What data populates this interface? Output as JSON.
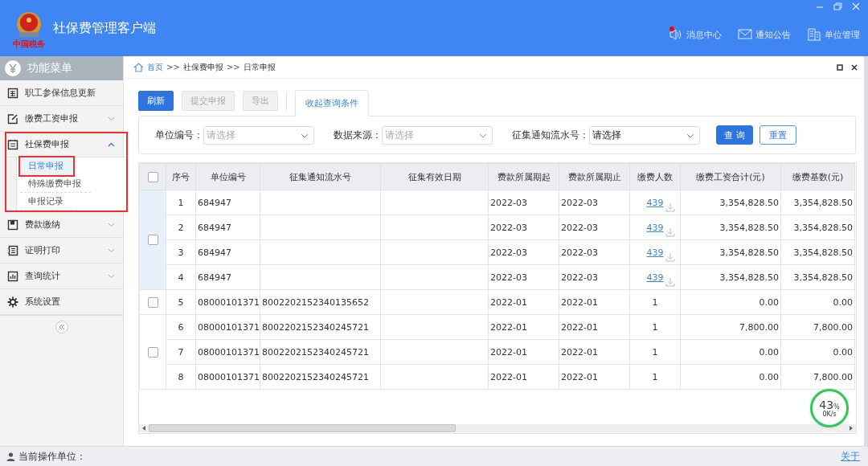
{
  "window": {
    "title": "社保费管理客户端",
    "logo_caption": "中国税务"
  },
  "header_nav": [
    {
      "label": "消息中心",
      "kind": "message",
      "unread": true
    },
    {
      "label": "通知公告",
      "kind": "notice",
      "unread": false
    },
    {
      "label": "单位管理",
      "kind": "unit",
      "unread": false
    }
  ],
  "sidebar": {
    "title": "功能菜单",
    "items": [
      {
        "label": "职工参保信息更新"
      },
      {
        "label": "缴费工资申报",
        "expanded": false
      },
      {
        "label": "社保费申报",
        "expanded": true,
        "annotated": true,
        "children": [
          {
            "label": "日常申报",
            "selected": true,
            "annotated": true
          },
          {
            "label": "特殊缴费申报",
            "selected": false
          },
          {
            "label": "申报记录",
            "selected": false
          }
        ]
      },
      {
        "label": "费款缴纳",
        "expanded": false
      },
      {
        "label": "证明打印",
        "expanded": false
      },
      {
        "label": "查询统计",
        "expanded": false
      },
      {
        "label": "系统设置"
      }
    ]
  },
  "breadcrumb": [
    {
      "text": "首页",
      "kind": "link"
    },
    {
      "text": ">>",
      "kind": "sep"
    },
    {
      "text": "社保费申报",
      "kind": "text"
    },
    {
      "text": ">>",
      "kind": "sep"
    },
    {
      "text": "日常申报",
      "kind": "text"
    }
  ],
  "toolbar": [
    {
      "label": "刷新",
      "kind": "primary",
      "disabled": false
    },
    {
      "label": "提交申报",
      "kind": "plain",
      "disabled": true
    },
    {
      "label": "导出",
      "kind": "plain",
      "disabled": true
    },
    {
      "label": "收起查询条件",
      "kind": "tab",
      "selected": true
    }
  ],
  "filters": [
    {
      "label": "单位编号：",
      "placeholder": "请选择"
    },
    {
      "label": "数据来源：",
      "placeholder": "请选择"
    },
    {
      "label": "征集通知流水号：",
      "value": "请选择"
    }
  ],
  "filter_buttons": [
    {
      "label": "查 询",
      "kind": "primary"
    },
    {
      "label": "重置",
      "kind": "outline"
    }
  ],
  "table": {
    "header_checked": false,
    "columns": [
      "序号",
      "单位编号",
      "征集通知流水号",
      "征集有效日期",
      "费款所属期起",
      "费款所属期止",
      "缴费人数",
      "缴费工资合计(元)",
      "缴费基数(元)"
    ],
    "groups": [
      {
        "checked": false,
        "selected": true,
        "rows": [
          {
            "no": "1",
            "unit": "684947",
            "period_from": "2022-03",
            "period_to": "2022-03",
            "payers": "439",
            "link": true,
            "wages": "3,354,828.50",
            "base": "3,354,828.50"
          },
          {
            "no": "2",
            "unit": "684947",
            "period_from": "2022-03",
            "period_to": "2022-03",
            "payers": "439",
            "link": true,
            "wages": "3,354,828.50",
            "base": "3,354,828.50"
          },
          {
            "no": "3",
            "unit": "684947",
            "period_from": "2022-03",
            "period_to": "2022-03",
            "payers": "439",
            "link": true,
            "wages": "3,354,828.50",
            "base": "3,354,828.50"
          },
          {
            "no": "4",
            "unit": "684947",
            "period_from": "2022-03",
            "period_to": "2022-03",
            "payers": "439",
            "link": true,
            "wages": "3,354,828.50",
            "base": "3,354,828.50"
          }
        ]
      },
      {
        "checked": false,
        "selected": false,
        "rows": [
          {
            "no": "5",
            "unit": "08000101371",
            "notice_no": "8002202152340135652",
            "period_from": "2022-01",
            "period_to": "2022-01",
            "payers": "1",
            "link": false,
            "wages": "0.00",
            "base": "0.00"
          }
        ]
      },
      {
        "checked": false,
        "selected": false,
        "rows": [
          {
            "no": "6",
            "unit": "08000101371",
            "notice_no": "8002202152340245721",
            "period_from": "2022-01",
            "period_to": "2022-01",
            "payers": "1",
            "link": false,
            "wages": "7,800.00",
            "base": "7,800.00"
          },
          {
            "no": "7",
            "unit": "08000101371",
            "notice_no": "8002202152340245721",
            "period_from": "2022-01",
            "period_to": "2022-01",
            "payers": "1",
            "link": false,
            "wages": "0.00",
            "base": "0.00"
          },
          {
            "no": "8",
            "unit": "08000101371",
            "notice_no": "8002202152340245721",
            "period_from": "2022-01",
            "period_to": "2022-01",
            "payers": "1",
            "link": false,
            "wages": "0.00",
            "base": "7,800.00"
          }
        ]
      }
    ]
  },
  "speed_meter": {
    "percent": "43",
    "unit": "%",
    "rate": "0K/s"
  },
  "status_bar": {
    "label": "当前操作单位：",
    "link": "关于"
  }
}
